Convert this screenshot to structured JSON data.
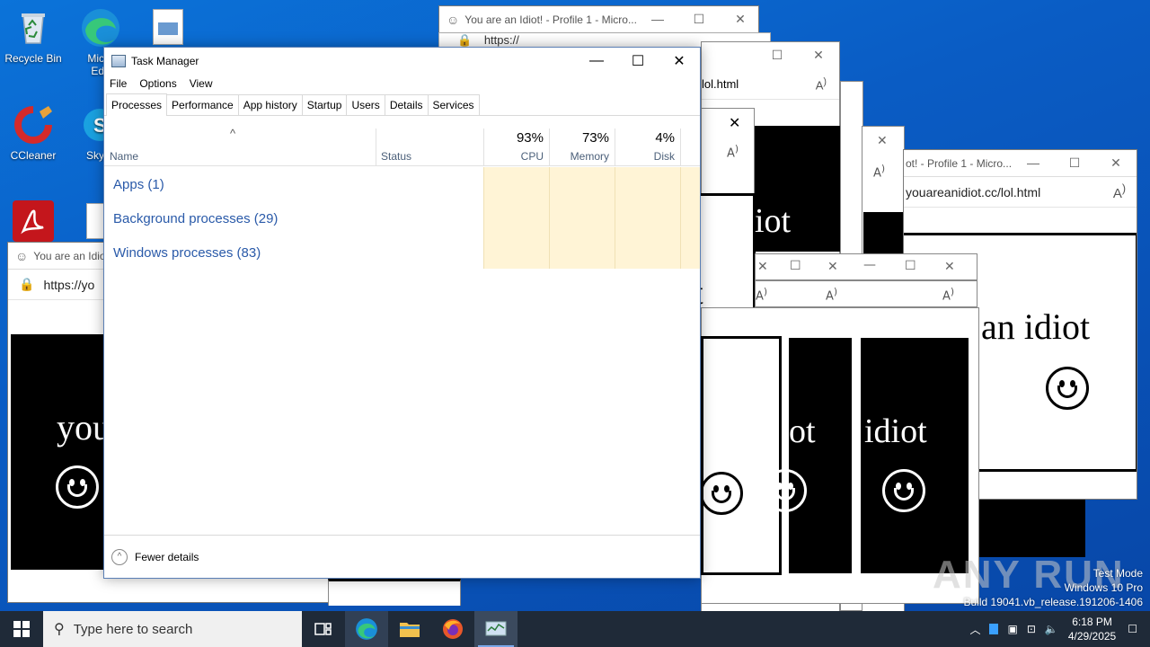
{
  "desktop": {
    "icons": [
      {
        "label": "Recycle Bin",
        "icon": "recycle-bin-icon"
      },
      {
        "label": "Micro\nEdg",
        "icon": "edge-icon"
      },
      {
        "label": "CCleaner",
        "icon": "ccleaner-icon"
      },
      {
        "label": "Sky",
        "icon": "skype-icon"
      },
      {
        "label": "",
        "icon": "acrobat-icon"
      }
    ]
  },
  "browser_windows": {
    "title_full": "You are an Idiot! - Profile 1 - Micro...",
    "title_short": "You are an Idiot",
    "title_right": "ot! - Profile 1 - Micro...",
    "url_https": "https://",
    "url_https_yo": "https://yo",
    "url_lol": "lol.html",
    "url_full": "youareanidiot.cc/lol.html",
    "text_you": "you",
    "text_idiot": "idiot",
    "text_an_idiot": "an idiot",
    "text_ot": "ot",
    "text_iot": "iot",
    "text_t": "t"
  },
  "task_manager": {
    "title": "Task Manager",
    "menu": [
      "File",
      "Options",
      "View"
    ],
    "tabs": [
      "Processes",
      "Performance",
      "App history",
      "Startup",
      "Users",
      "Details",
      "Services"
    ],
    "active_tab": "Processes",
    "columns": {
      "name": "Name",
      "status": "Status",
      "cpu_pct": "93%",
      "cpu_label": "CPU",
      "memory_pct": "73%",
      "memory_label": "Memory",
      "disk_pct": "4%",
      "disk_label": "Disk"
    },
    "groups": [
      {
        "label": "Apps (1)"
      },
      {
        "label": "Background processes (29)"
      },
      {
        "label": "Windows processes (83)"
      }
    ],
    "footer": "Fewer details",
    "heat_color": "#fff4d6"
  },
  "watermark": {
    "brand": "ANY RUN",
    "line1": "Test Mode",
    "line2": "Windows 10 Pro",
    "line3": "Build 19041.vb_release.191206-1406"
  },
  "taskbar": {
    "search_placeholder": "Type here to search",
    "time": "6:18 PM",
    "date": "4/29/2025"
  }
}
